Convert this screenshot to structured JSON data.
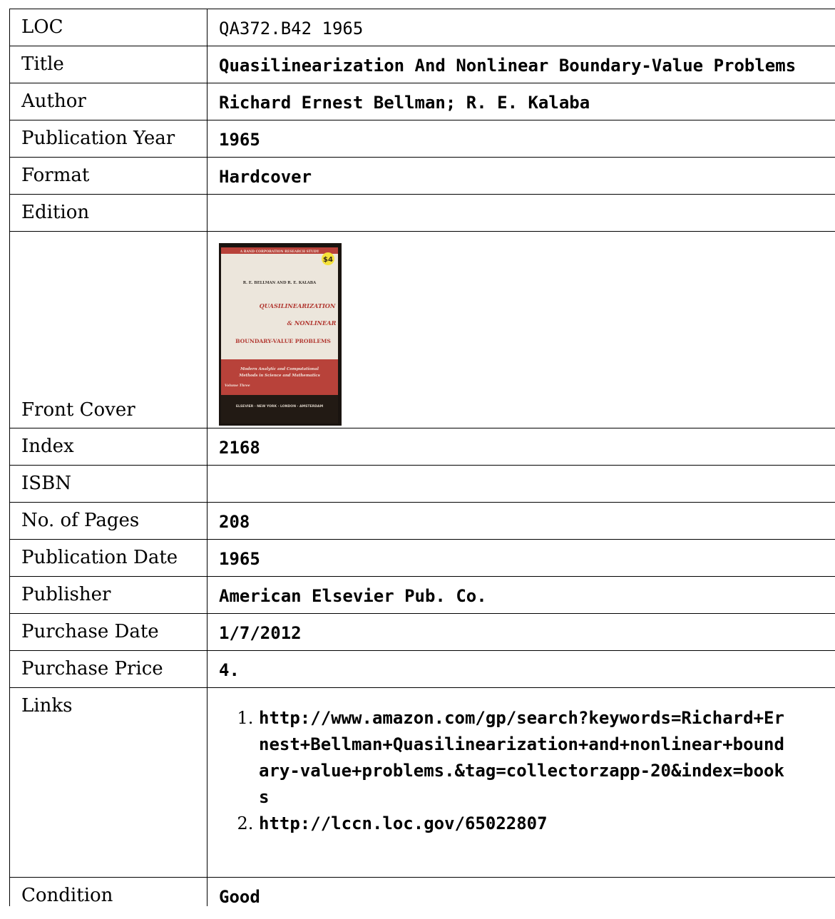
{
  "rows": [
    {
      "label": "LOC",
      "value": "QA372.B42 1965"
    },
    {
      "label": "Title",
      "value": "Quasilinearization And Nonlinear Boundary-Value Problems"
    },
    {
      "label": "Author",
      "value": "Richard Ernest Bellman; R. E. Kalaba"
    },
    {
      "label": "Publication Year",
      "value": "1965"
    },
    {
      "label": "Format",
      "value": "Hardcover"
    },
    {
      "label": "Edition",
      "value": ""
    },
    {
      "label": "Front Cover",
      "value": ""
    },
    {
      "label": "Index",
      "value": "2168"
    },
    {
      "label": "ISBN",
      "value": ""
    },
    {
      "label": "No. of Pages",
      "value": "208"
    },
    {
      "label": "Publication Date",
      "value": "1965"
    },
    {
      "label": "Publisher",
      "value": "American Elsevier Pub. Co."
    },
    {
      "label": "Purchase Date",
      "value": "1/7/2012"
    },
    {
      "label": "Purchase Price",
      "value": "4."
    },
    {
      "label": "Links",
      "value": ""
    },
    {
      "label": "Condition",
      "value": "Good"
    }
  ],
  "links": [
    "http://www.amazon.com/gp/search?keywords=Richard+Ernest+Bellman+Quasilinearization+and+nonlinear+boundary-value+problems.&tag=collectorzapp-20&index=books",
    "http://lccn.loc.gov/65022807"
  ],
  "cover": {
    "series": "A RAND CORPORATION RESEARCH STUDY",
    "sticker": "$4",
    "authors": "R. E. BELLMAN AND R. E. KALABA",
    "title_line1": "QUASILINEARIZATION",
    "title_line2": "& NONLINEAR",
    "title_line3": "BOUNDARY-VALUE PROBLEMS",
    "band_line1": "Modern Analytic and Computational",
    "band_line2": "Methods in Science and Mathematics",
    "band_line3": "Volume Three",
    "publisher_line": "ELSEVIER · NEW YORK · LONDON · AMSTERDAM",
    "colors": {
      "paper": "#ece6dc",
      "red": "#b8423a",
      "dark": "#1a1410",
      "title_red": "#b23a33",
      "sticker": "#f5e23a"
    }
  }
}
